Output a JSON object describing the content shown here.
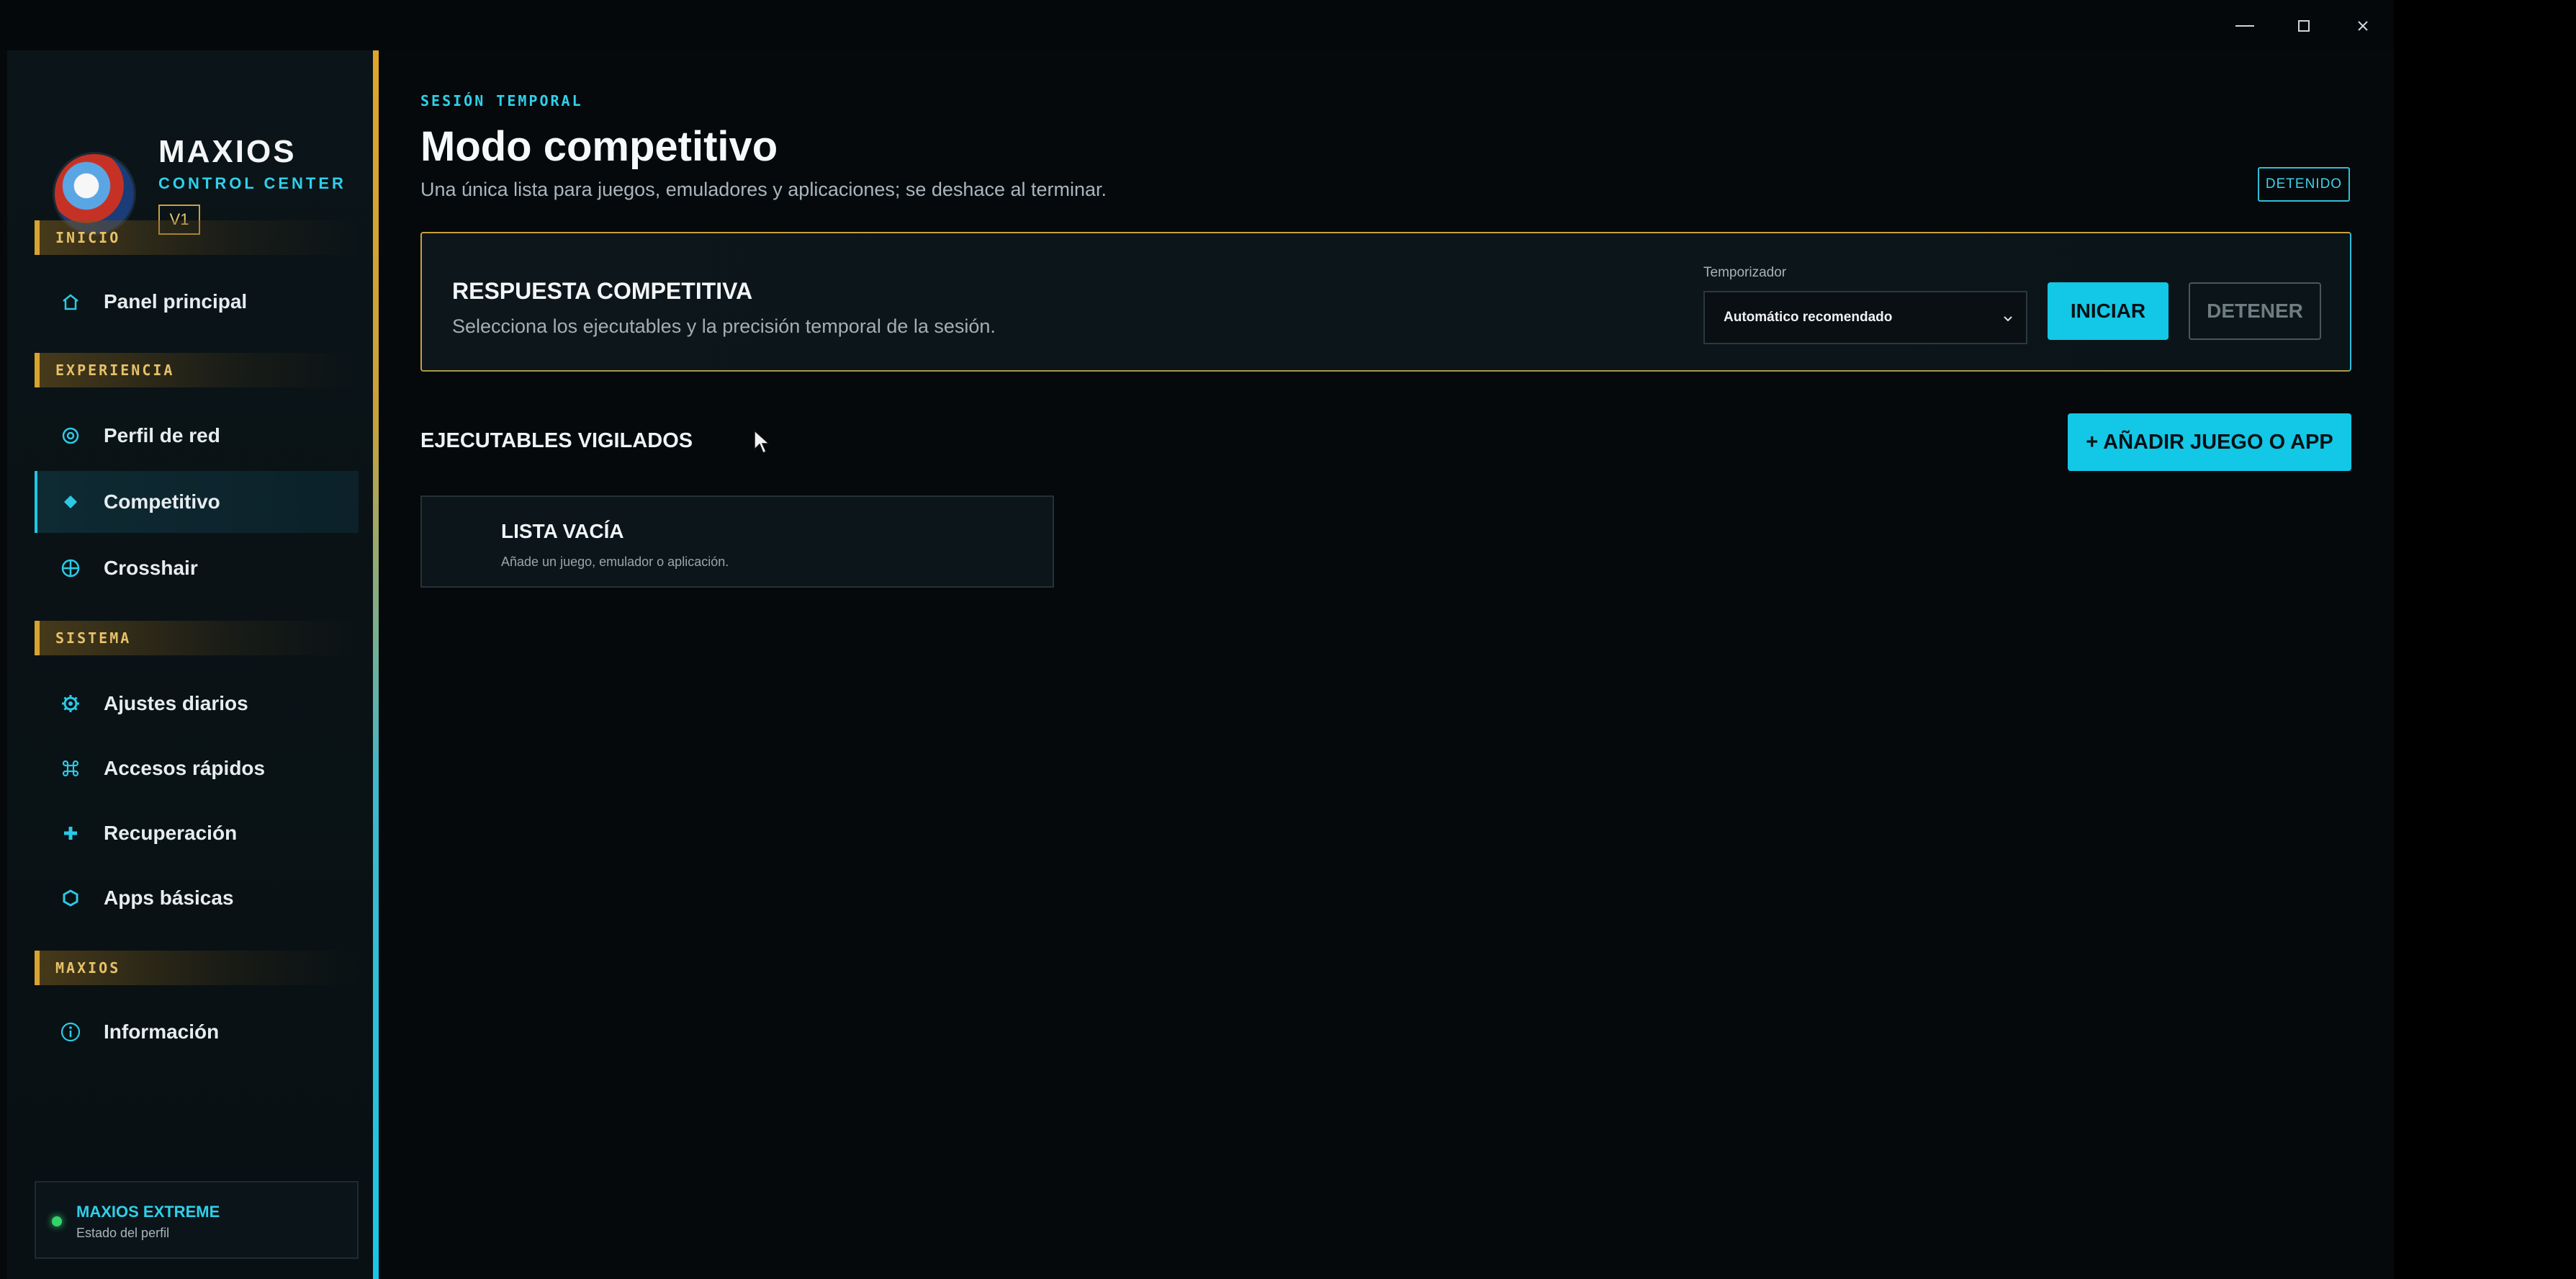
{
  "window": {
    "controls": {
      "minimize_icon": "minimize-icon",
      "maximize_icon": "maximize-icon",
      "close_icon": "close-icon"
    }
  },
  "brand": {
    "name": "MAXIOS",
    "subtitle": "CONTROL CENTER",
    "version": "V1"
  },
  "sidebar": {
    "sections": [
      {
        "label": "INICIO",
        "items": [
          {
            "label": "Panel principal",
            "icon": "home-icon"
          }
        ]
      },
      {
        "label": "EXPERIENCIA",
        "items": [
          {
            "label": "Perfil de red",
            "icon": "network-icon"
          },
          {
            "label": "Competitivo",
            "icon": "diamond-icon",
            "active": true
          },
          {
            "label": "Crosshair",
            "icon": "crosshair-icon"
          }
        ]
      },
      {
        "label": "SISTEMA",
        "items": [
          {
            "label": "Ajustes diarios",
            "icon": "gear-icon"
          },
          {
            "label": "Accesos rápidos",
            "icon": "command-icon"
          },
          {
            "label": "Recuperación",
            "icon": "plus-icon"
          },
          {
            "label": "Apps básicas",
            "icon": "hexagon-icon"
          }
        ]
      },
      {
        "label": "MAXIOS",
        "items": [
          {
            "label": "Información",
            "icon": "info-icon"
          }
        ]
      }
    ],
    "profile": {
      "name": "MAXIOS EXTREME",
      "subtitle": "Estado del perfil",
      "status_color": "#32d46b"
    }
  },
  "main": {
    "eyebrow": "SESIÓN TEMPORAL",
    "title": "Modo competitivo",
    "description": "Una única lista para juegos, emuladores y aplicaciones; se deshace al terminar.",
    "status_badge": "DETENIDO",
    "response_card": {
      "title": "RESPUESTA COMPETITIVA",
      "description": "Selecciona los ejecutables y la precisión temporal de la sesión.",
      "timer_label": "Temporizador",
      "timer_value": "Automático recomendado",
      "start_label": "INICIAR",
      "stop_label": "DETENER"
    },
    "executables": {
      "title": "EJECUTABLES VIGILADOS",
      "add_label": "+ AÑADIR JUEGO O APP",
      "empty_title": "LISTA VACÍA",
      "empty_desc": "Añade un juego, emulador o aplicación."
    }
  },
  "colors": {
    "accent": "#13c7e6",
    "gold": "#d8a32e",
    "background": "#05090c"
  }
}
